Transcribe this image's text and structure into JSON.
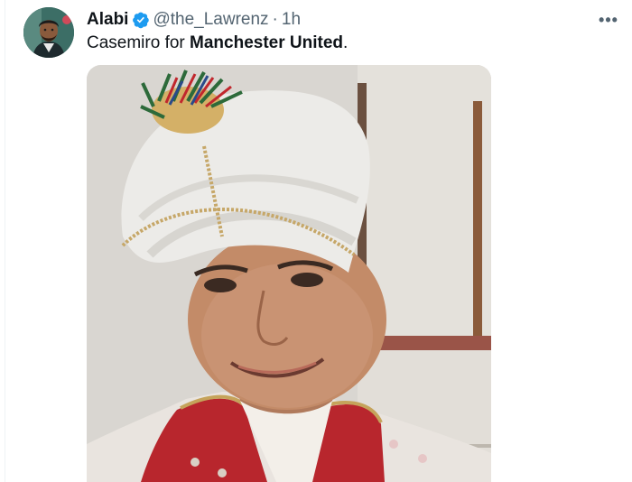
{
  "tweet": {
    "display_name": "Alabi",
    "handle": "@the_Lawrenz",
    "separator": "·",
    "time": "1h",
    "more_label": "•••",
    "text_prefix": "Casemiro for ",
    "text_bold": "Manchester United",
    "text_suffix": "."
  },
  "colors": {
    "verified_badge": "#1d9bf0",
    "secondary_text": "#536471",
    "primary_text": "#0f1419"
  },
  "icons": {
    "verified": "verified-badge-icon",
    "more": "more-horizontal-icon"
  }
}
